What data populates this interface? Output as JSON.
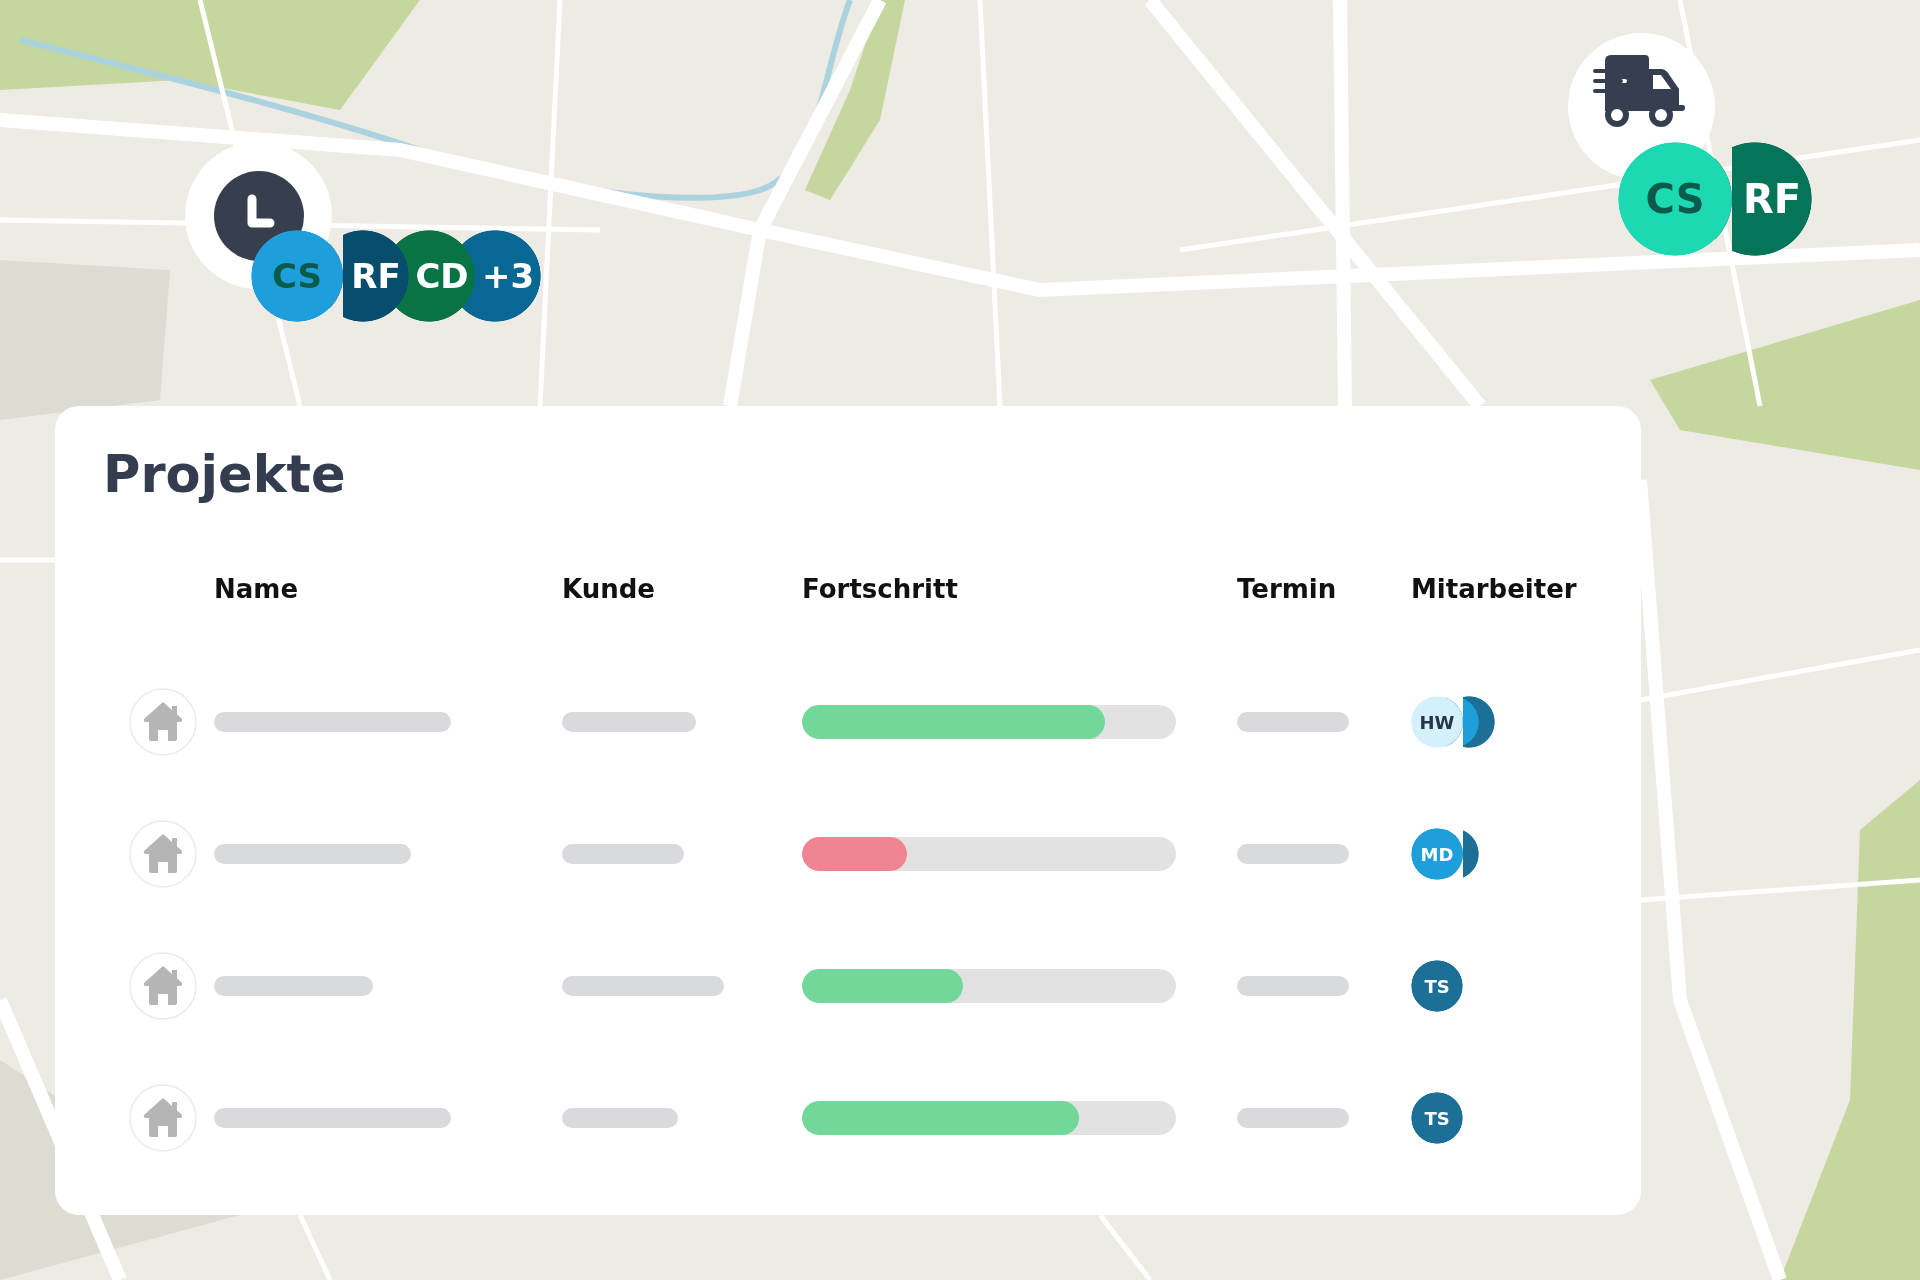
{
  "markers": [
    {
      "kind": "clock",
      "avatars": [
        {
          "initials": "CS",
          "color": "#1e9fdb"
        },
        {
          "initials": "RF",
          "color": "#074d6e"
        },
        {
          "initials": "CD",
          "color": "#087444"
        },
        {
          "initials": "+3",
          "color": "#086893"
        }
      ]
    },
    {
      "kind": "truck",
      "avatars": [
        {
          "initials": "CS",
          "color": "#1cd9b3"
        },
        {
          "initials": "RF",
          "color": "#067459"
        }
      ]
    }
  ],
  "card": {
    "title": "Projekte",
    "columns": [
      "Name",
      "Kunde",
      "Fortschritt",
      "Termin",
      "Mitarbeiter"
    ],
    "rows": [
      {
        "progress": {
          "level": 0.81,
          "color": "#72d89a"
        },
        "avatars": [
          {
            "initials": "HW",
            "color": "#d5f0fd"
          },
          {
            "color": "#1e9fdb"
          },
          {
            "color": "#1c6f96"
          }
        ]
      },
      {
        "progress": {
          "level": 0.28,
          "color": "#ef8592"
        },
        "avatars": [
          {
            "initials": "MD",
            "color": "#1e9fdb"
          },
          {
            "color": "#1c6f96"
          }
        ]
      },
      {
        "progress": {
          "level": 0.43,
          "color": "#72d89a"
        },
        "avatars": [
          {
            "initials": "TS",
            "color": "#1c6f96"
          }
        ]
      },
      {
        "progress": {
          "level": 0.74,
          "color": "#72d89a"
        },
        "avatars": [
          {
            "initials": "TS",
            "color": "#1c6f96"
          }
        ]
      }
    ]
  }
}
